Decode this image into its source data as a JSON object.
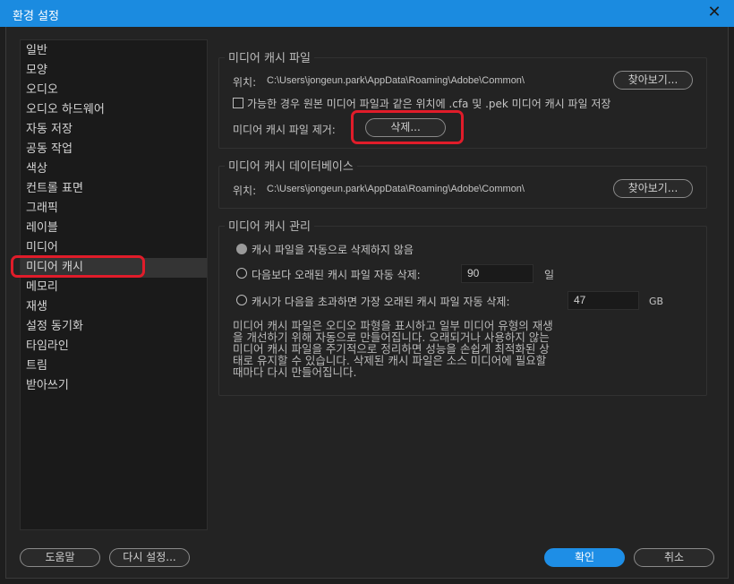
{
  "window": {
    "title": "환경 설정",
    "close_glyph": "✕"
  },
  "sidebar": {
    "items": [
      {
        "label": "일반"
      },
      {
        "label": "모양"
      },
      {
        "label": "오디오"
      },
      {
        "label": "오디오 하드웨어"
      },
      {
        "label": "자동 저장"
      },
      {
        "label": "공동 작업"
      },
      {
        "label": "색상"
      },
      {
        "label": "컨트롤 표면"
      },
      {
        "label": "그래픽"
      },
      {
        "label": "레이블"
      },
      {
        "label": "미디어"
      },
      {
        "label": "미디어 캐시"
      },
      {
        "label": "메모리"
      },
      {
        "label": "재생"
      },
      {
        "label": "설정 동기화"
      },
      {
        "label": "타임라인"
      },
      {
        "label": "트림"
      },
      {
        "label": "받아쓰기"
      }
    ],
    "selected": "미디어 캐시"
  },
  "cache_files": {
    "group_label": "미디어 캐시 파일",
    "location_label": "위치:",
    "location_path": "C:\\Users\\jongeun.park\\AppData\\Roaming\\Adobe\\Common\\",
    "browse_label": "찾아보기...",
    "checkbox_label": "가능한 경우 원본 미디어 파일과 같은 위치에 .cfa 및 .pek 미디어 캐시 파일 저장",
    "checkbox_checked": false,
    "remove_label": "미디어 캐시 파일 제거:",
    "delete_label": "삭제..."
  },
  "cache_db": {
    "group_label": "미디어 캐시 데이터베이스",
    "location_label": "위치:",
    "location_path": "C:\\Users\\jongeun.park\\AppData\\Roaming\\Adobe\\Common\\",
    "browse_label": "찾아보기..."
  },
  "cache_manage": {
    "group_label": "미디어 캐시 관리",
    "option_no_delete": "캐시 파일을 자동으로 삭제하지 않음",
    "option_older_than": "다음보다 오래된 캐시 파일 자동 삭제:",
    "older_than_value": "90",
    "older_than_unit": "일",
    "option_exceeds": "캐시가 다음을 초과하면 가장 오래된 캐시 파일 자동 삭제:",
    "exceeds_value": "47",
    "exceeds_unit": "GB",
    "selected_option": "option_no_delete",
    "description_lines": [
      "미디어 캐시 파일은 오디오 파형을 표시하고 일부 미디어 유형의 재생",
      "을 개선하기 위해 자동으로 만들어집니다. 오래되거나 사용하지 않는",
      "미디어 캐시 파일을 주기적으로 정리하면 성능을 손쉽게 최적화된 상",
      "태로 유지할 수 있습니다. 삭제된 캐시 파일은 소스 미디어에 필요할",
      "때마다 다시 만들어집니다."
    ]
  },
  "footer": {
    "help_label": "도움말",
    "reset_label": "다시 설정...",
    "ok_label": "확인",
    "cancel_label": "취소"
  },
  "colors": {
    "titlebar": "#1b8be0",
    "primary_button": "#1e8ee6",
    "annotation": "#e01c2a"
  }
}
